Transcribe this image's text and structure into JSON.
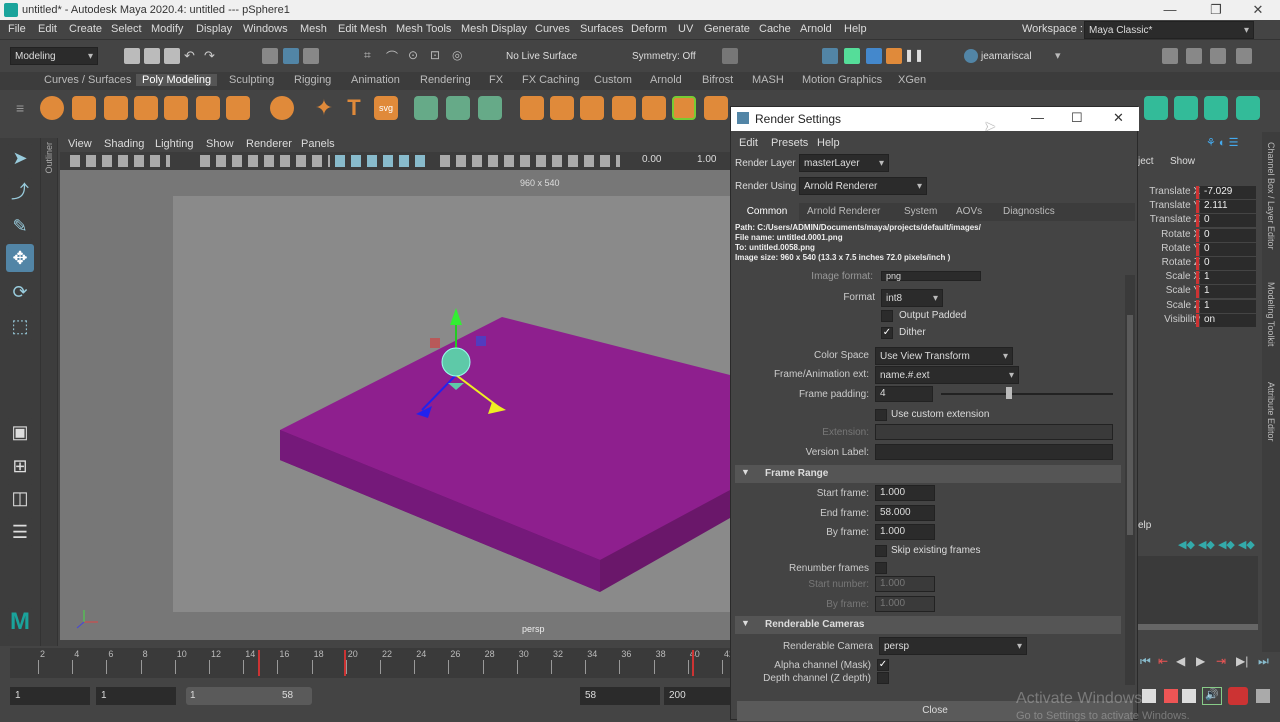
{
  "window": {
    "title": "untitled* - Autodesk Maya 2020.4: untitled   ---   pSphere1"
  },
  "menubar": [
    "File",
    "Edit",
    "Create",
    "Select",
    "Modify",
    "Display",
    "Windows",
    "Mesh",
    "Edit Mesh",
    "Mesh Tools",
    "Mesh Display",
    "Curves",
    "Surfaces",
    "Deform",
    "UV",
    "Generate",
    "Cache",
    "Arnold",
    "Help"
  ],
  "workspace": {
    "label": "Workspace :",
    "value": "Maya Classic*"
  },
  "statusline": {
    "menuset": "Modeling",
    "live_surface": "No Live Surface",
    "symmetry": "Symmetry: Off",
    "user": "jeamariscal"
  },
  "shelf_tabs": [
    "Curves / Surfaces",
    "Poly Modeling",
    "Sculpting",
    "Rigging",
    "Animation",
    "Rendering",
    "FX",
    "FX Caching",
    "Custom",
    "Arnold",
    "Bifrost",
    "MASH",
    "Motion Graphics",
    "XGen"
  ],
  "shelf_active": "Poly Modeling",
  "panel_menu": [
    "View",
    "Shading",
    "Lighting",
    "Show",
    "Renderer",
    "Panels"
  ],
  "panel_toolbar": {
    "val1": "0.00",
    "val2": "1.00"
  },
  "viewport": {
    "resolution": "960 x 540",
    "camera": "persp"
  },
  "outliner_label": "Outliner",
  "timeline": {
    "ticks": [
      "2",
      "4",
      "6",
      "8",
      "10",
      "12",
      "14",
      "16",
      "18",
      "20",
      "22",
      "24",
      "26",
      "28",
      "30",
      "32",
      "34",
      "36",
      "38",
      "40",
      "42"
    ]
  },
  "range": {
    "start": "1",
    "start2": "1",
    "slider_start": "1",
    "slider_end": "58",
    "end": "58",
    "end2": "200"
  },
  "render_settings": {
    "title": "Render Settings",
    "menu": [
      "Edit",
      "Presets",
      "Help"
    ],
    "render_layer_label": "Render Layer",
    "render_layer": "masterLayer",
    "render_using_label": "Render Using",
    "render_using": "Arnold Renderer",
    "tabs": [
      "Common",
      "Arnold Renderer",
      "System",
      "AOVs",
      "Diagnostics"
    ],
    "path_info": [
      "Path: C:/Users/ADMIN/Documents/maya/projects/default/images/",
      "File name:  untitled.0001.png",
      "To:              untitled.0058.png",
      "Image size: 960 x 540 (13.3 x 7.5 inches 72.0 pixels/inch )"
    ],
    "image_format_label": "Image format:",
    "image_format": "png",
    "format_label": "Format",
    "format": "int8",
    "output_padded": "Output Padded",
    "dither": "Dither",
    "color_space_label": "Color Space",
    "color_space": "Use View Transform",
    "frame_anim_label": "Frame/Animation ext:",
    "frame_anim": "name.#.ext",
    "frame_padding_label": "Frame padding:",
    "frame_padding": "4",
    "use_custom_ext": "Use custom extension",
    "extension_label": "Extension:",
    "version_label": "Version Label:",
    "frame_range_section": "Frame Range",
    "start_frame_label": "Start frame:",
    "start_frame": "1.000",
    "end_frame_label": "End frame:",
    "end_frame": "58.000",
    "by_frame_label": "By frame:",
    "by_frame": "1.000",
    "skip_existing": "Skip existing frames",
    "renumber_label": "Renumber frames",
    "renum_start_label": "Start number:",
    "renum_start": "1.000",
    "renum_by_label": "By frame:",
    "renum_by": "1.000",
    "cameras_section": "Renderable Cameras",
    "renderable_camera_label": "Renderable Camera",
    "renderable_camera": "persp",
    "alpha_label": "Alpha channel (Mask)",
    "depth_label": "Depth channel (Z depth)",
    "close": "Close"
  },
  "channel_box": {
    "header": [
      "ject",
      "Show"
    ],
    "channels": [
      {
        "name": "Translate X",
        "value": "-7.029"
      },
      {
        "name": "Translate Y",
        "value": "2.111"
      },
      {
        "name": "Translate Z",
        "value": "0"
      },
      {
        "name": "Rotate X",
        "value": "0"
      },
      {
        "name": "Rotate Y",
        "value": "0"
      },
      {
        "name": "Rotate Z",
        "value": "0"
      },
      {
        "name": "Scale X",
        "value": "1"
      },
      {
        "name": "Scale Y",
        "value": "1"
      },
      {
        "name": "Scale Z",
        "value": "1"
      },
      {
        "name": "Visibility",
        "value": "on"
      }
    ],
    "help": "elp"
  },
  "right_strip": [
    "Channel Box / Layer Editor",
    "Modeling Toolkit",
    "Attribute Editor"
  ],
  "watermark": {
    "line1": "Activate Windows",
    "line2": "Go to Settings to activate Windows."
  },
  "colors": {
    "plane": "#8e1f8e",
    "accent": "#5285a6",
    "arnold_orange": "#e08a3a"
  }
}
